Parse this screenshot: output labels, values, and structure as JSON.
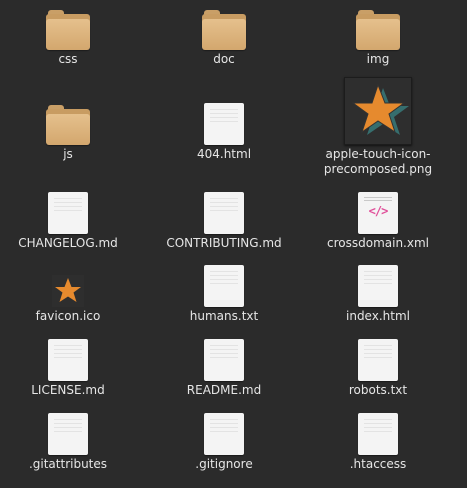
{
  "files": [
    {
      "name": "css",
      "kind": "folder"
    },
    {
      "name": "doc",
      "kind": "folder"
    },
    {
      "name": "img",
      "kind": "folder"
    },
    {
      "name": "js",
      "kind": "folder"
    },
    {
      "name": "404.html",
      "kind": "document"
    },
    {
      "name": "apple-touch-icon-\nprecomposed.png",
      "kind": "image-large"
    },
    {
      "name": "CHANGELOG.md",
      "kind": "document"
    },
    {
      "name": "CONTRIBUTING.md",
      "kind": "document"
    },
    {
      "name": "crossdomain.xml",
      "kind": "xml"
    },
    {
      "name": "favicon.ico",
      "kind": "image-small"
    },
    {
      "name": "humans.txt",
      "kind": "document"
    },
    {
      "name": "index.html",
      "kind": "document"
    },
    {
      "name": "LICENSE.md",
      "kind": "document"
    },
    {
      "name": "README.md",
      "kind": "document"
    },
    {
      "name": "robots.txt",
      "kind": "document"
    },
    {
      "name": ".gitattributes",
      "kind": "document"
    },
    {
      "name": ".gitignore",
      "kind": "document"
    },
    {
      "name": ".htaccess",
      "kind": "document"
    }
  ],
  "colors": {
    "background": "#2b2b2b",
    "folder": "#dcb27b",
    "star": "#e68a2e",
    "xml_accent": "#e0509a",
    "label": "#e6e6e6"
  },
  "xml_glyph": "</>"
}
